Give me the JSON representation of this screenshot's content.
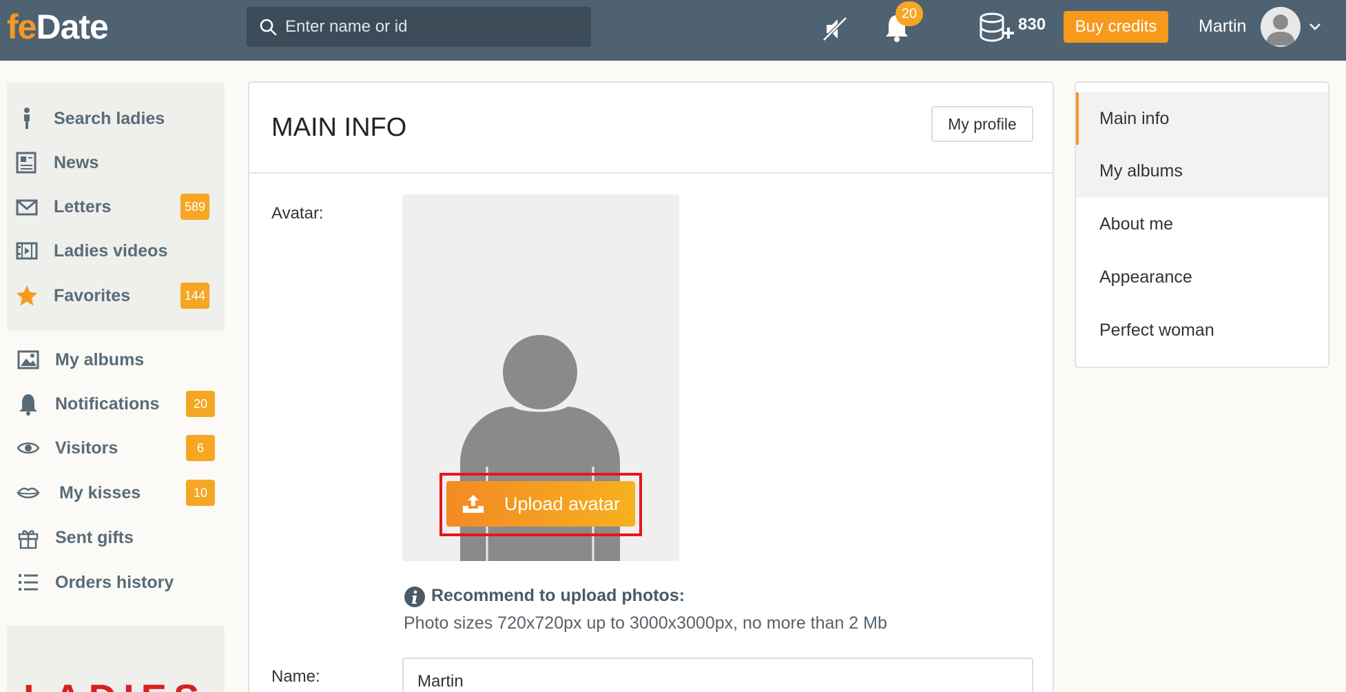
{
  "header": {
    "logo_fe": "fe",
    "logo_date": "Date",
    "search_placeholder": "Enter name or id",
    "notifications_count": "20",
    "credits": "830",
    "buy_credits_label": "Buy credits",
    "user_name": "Martin"
  },
  "sidebar": {
    "primary_items": [
      {
        "label": "Search ladies",
        "icon": "person-icon"
      },
      {
        "label": "News",
        "icon": "newspaper-icon"
      },
      {
        "label": "Letters",
        "icon": "envelope-icon",
        "badge": "589"
      },
      {
        "label": "Ladies videos",
        "icon": "film-icon"
      },
      {
        "label": "Favorites",
        "icon": "star-icon",
        "badge": "144"
      }
    ],
    "secondary_items": [
      {
        "label": "My albums",
        "icon": "image-icon"
      },
      {
        "label": "Notifications",
        "icon": "bell-icon",
        "badge": "20"
      },
      {
        "label": "Visitors",
        "icon": "eye-icon",
        "badge": "6"
      },
      {
        "label": "My kisses",
        "icon": "lips-icon",
        "badge": "10"
      },
      {
        "label": "Sent gifts",
        "icon": "gift-icon"
      },
      {
        "label": "Orders history",
        "icon": "list-icon"
      }
    ],
    "banner_text": "LADIES"
  },
  "main": {
    "title": "MAIN INFO",
    "my_profile_label": "My profile",
    "avatar_label": "Avatar:",
    "upload_label": "Upload avatar",
    "recommend_title": "Recommend to upload photos:",
    "recommend_text": "Photo sizes 720x720px up to 3000x3000px, no more than 2 Mb",
    "name_label": "Name:",
    "name_value": "Martin"
  },
  "right_menu": {
    "items": [
      "Main info",
      "My albums",
      "About me",
      "Appearance",
      "Perfect woman"
    ],
    "active": "Main info"
  },
  "colors": {
    "header_bg": "#4f6272",
    "accent_orange": "#f5a623",
    "highlight_red": "#e8141b"
  }
}
